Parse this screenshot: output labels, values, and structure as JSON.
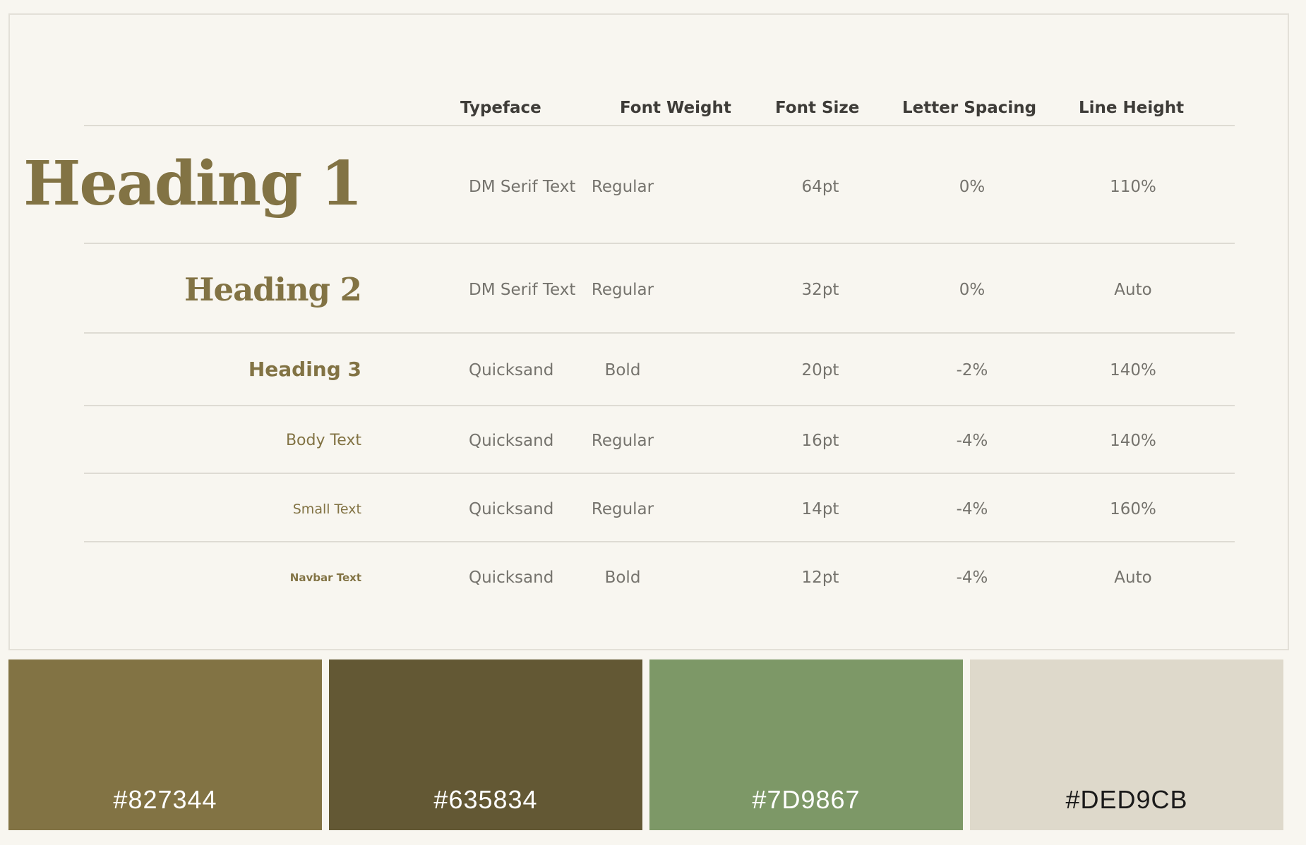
{
  "table": {
    "headers": {
      "typeface": "Typeface",
      "font_weight": "Font Weight",
      "font_size": "Font Size",
      "letter_spacing": "Letter Spacing",
      "line_height": "Line Height"
    },
    "rows": [
      {
        "sample": "Heading 1",
        "typeface": "DM Serif Text",
        "font_weight": "Regular",
        "font_size": "64pt",
        "letter_spacing": "0%",
        "line_height": "110%"
      },
      {
        "sample": "Heading 2",
        "typeface": "DM Serif Text",
        "font_weight": "Regular",
        "font_size": "32pt",
        "letter_spacing": "0%",
        "line_height": "Auto"
      },
      {
        "sample": "Heading 3",
        "typeface": "Quicksand",
        "font_weight": "Bold",
        "font_size": "20pt",
        "letter_spacing": "-2%",
        "line_height": "140%"
      },
      {
        "sample": "Body Text",
        "typeface": "Quicksand",
        "font_weight": "Regular",
        "font_size": "16pt",
        "letter_spacing": "-4%",
        "line_height": "140%"
      },
      {
        "sample": "Small Text",
        "typeface": "Quicksand",
        "font_weight": "Regular",
        "font_size": "14pt",
        "letter_spacing": "-4%",
        "line_height": "160%"
      },
      {
        "sample": "Navbar Text",
        "typeface": "Quicksand",
        "font_weight": "Bold",
        "font_size": "12pt",
        "letter_spacing": "-4%",
        "line_height": "Auto"
      }
    ]
  },
  "palette": [
    {
      "hex": "#827344",
      "color": "#827344",
      "text_color": "#ffffff"
    },
    {
      "hex": "#635834",
      "color": "#635834",
      "text_color": "#ffffff"
    },
    {
      "hex": "#7D9867",
      "color": "#7D9867",
      "text_color": "#ffffff"
    },
    {
      "hex": "#DED9CB",
      "color": "#DED9CB",
      "text_color": "#1a1a1a"
    }
  ],
  "colors": {
    "sample_text": "#827344",
    "background": "#f8f6f0"
  }
}
